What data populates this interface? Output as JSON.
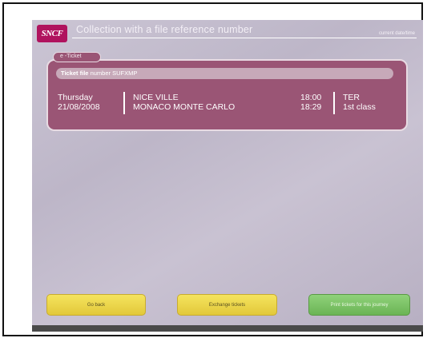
{
  "header": {
    "logo_text": "SNCF",
    "title": "Collection with a file reference number",
    "datetime": "current date/time"
  },
  "ticket": {
    "tag_label": "e -Ticket",
    "file_label": "Ticket file",
    "file_number_text": "number SUFXMP",
    "day": "Thursday",
    "date": "21/08/2008",
    "from_station": "NICE VILLE",
    "to_station": "MONACO MONTE CARLO",
    "depart_time": "18:00",
    "arrive_time": "18:29",
    "train_type": "TER",
    "travel_class": "1st class"
  },
  "buttons": {
    "go_back": "Go back",
    "exchange": "Exchange tickets",
    "print": "Print tickets for this journey"
  },
  "colors": {
    "brand": "#b0135e",
    "ticket_bg": "#9a5575",
    "button_yellow": "#f0d84a",
    "button_green": "#7cc466"
  }
}
